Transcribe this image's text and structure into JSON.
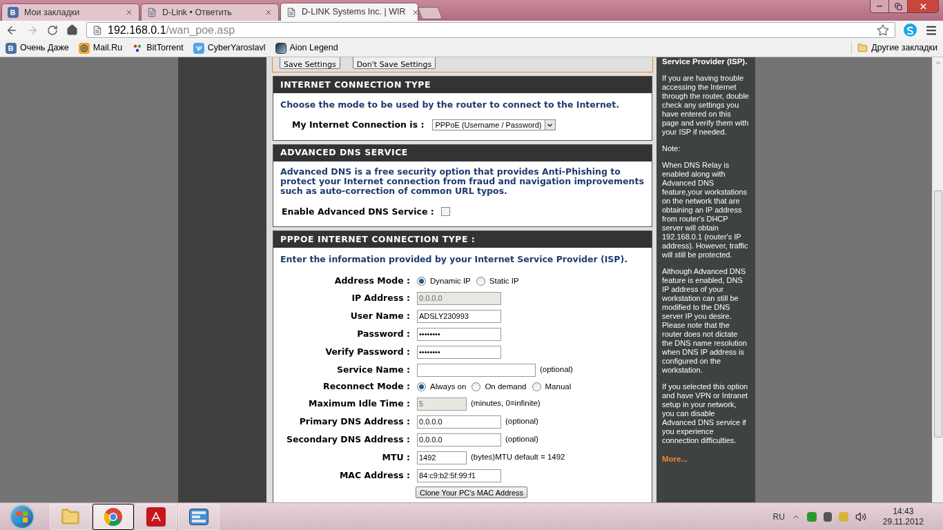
{
  "browser": {
    "tabs": [
      {
        "label": "Мои закладки",
        "selected": false
      },
      {
        "label": "D-Link • Ответить",
        "selected": false
      },
      {
        "label": "D-LINK Systems Inc. | WIR",
        "selected": true
      }
    ],
    "address": {
      "host": "192.168.0.1",
      "path": "/wan_poe.asp"
    },
    "bookmarks": [
      "Очень Даже",
      "Mail.Ru",
      "BitTorrent",
      "CyberYaroslavl",
      "Aion Legend"
    ],
    "other_bookmarks": "Другие закладки"
  },
  "page": {
    "top_buttons": [
      "Save Settings",
      "Don't Save Settings"
    ],
    "connection_type": {
      "title": "INTERNET CONNECTION TYPE",
      "intro": "Choose the mode to be used by the router to connect to the Internet.",
      "label": "My Internet Connection is :",
      "select_value": "PPPoE (Username / Password)"
    },
    "advanced_dns": {
      "title": "ADVANCED DNS SERVICE",
      "description": "Advanced DNS is a free security option that provides Anti-Phishing to protect your Internet connection from fraud and navigation improvements such as auto-correction of common URL typos.",
      "checkbox_label": "Enable Advanced DNS Service :",
      "checked": false
    },
    "pppoe": {
      "title": "PPPOE INTERNET CONNECTION TYPE :",
      "intro": "Enter the information provided by your Internet Service Provider (ISP).",
      "rows": [
        {
          "kind": "radio",
          "label": "Address Mode :",
          "options": [
            {
              "label": "Dynamic IP",
              "selected": true
            },
            {
              "label": "Static IP",
              "selected": false
            }
          ]
        },
        {
          "kind": "field",
          "label": "IP Address :",
          "value": "0.0.0.0",
          "disabled": true
        },
        {
          "kind": "field",
          "label": "User Name :",
          "value": "ADSLY230993",
          "disabled": false
        },
        {
          "kind": "field",
          "label": "Password :",
          "value": "••••••••",
          "disabled": false
        },
        {
          "kind": "field",
          "label": "Verify Password :",
          "value": "••••••••",
          "disabled": false
        },
        {
          "kind": "field",
          "label": "Service Name :",
          "value": "",
          "disabled": false,
          "note": "(optional)"
        },
        {
          "kind": "radio",
          "label": "Reconnect Mode :",
          "options": [
            {
              "label": "Always on",
              "selected": true
            },
            {
              "label": "On demand",
              "selected": false
            },
            {
              "label": "Manual",
              "selected": false
            }
          ]
        },
        {
          "kind": "field",
          "label": "Maximum Idle Time :",
          "value": "5",
          "disabled": true,
          "note": "(minutes, 0=infinite)"
        },
        {
          "kind": "field",
          "label": "Primary DNS Address :",
          "value": "0.0.0.0",
          "disabled": false,
          "note": "(optional)"
        },
        {
          "kind": "field",
          "label": "Secondary DNS Address :",
          "value": "0.0.0.0",
          "disabled": false,
          "note": "(optional)"
        },
        {
          "kind": "field",
          "label": "MTU :",
          "value": "1492",
          "disabled": false,
          "note": "(bytes)MTU default = 1492"
        },
        {
          "kind": "field",
          "label": "MAC Address :",
          "value": "84:c9:b2:5f:99:f1",
          "disabled": false
        },
        {
          "kind": "button",
          "label": "Clone Your PC's MAC Address"
        }
      ]
    }
  },
  "help": {
    "heading": "Service Provider (ISP).",
    "paragraphs": [
      "If you are having trouble accessing the Internet through the router, double check any settings you have entered on this page and verify them with your ISP if needed.",
      "Note:",
      "When DNS Relay is enabled along with Advanced DNS feature,your workstations on the network that are obtaining an IP address from router's DHCP server will obtain 192.168.0.1 (router's IP address). However, traffic will still be protected.",
      "Although Advanced DNS feature is enabled, DNS IP address of your workstation can still be modified to the DNS server IP you desire. Please note that the router does not dictate the DNS name resolution when DNS IP address is configured on the workstation.",
      "If you selected this option and have VPN or Intranet setup in your network, you can disable Advanced DNS service if you experience connection difficulties."
    ],
    "more": "More..."
  },
  "taskbar": {
    "apps": [
      {
        "kind": "folder",
        "selected": false
      },
      {
        "kind": "chrome",
        "selected": true
      },
      {
        "kind": "pdf",
        "selected": false
      },
      {
        "kind": "panel",
        "selected": false
      }
    ],
    "language": "RU",
    "time": "14:43",
    "date": "29.11.2012"
  }
}
